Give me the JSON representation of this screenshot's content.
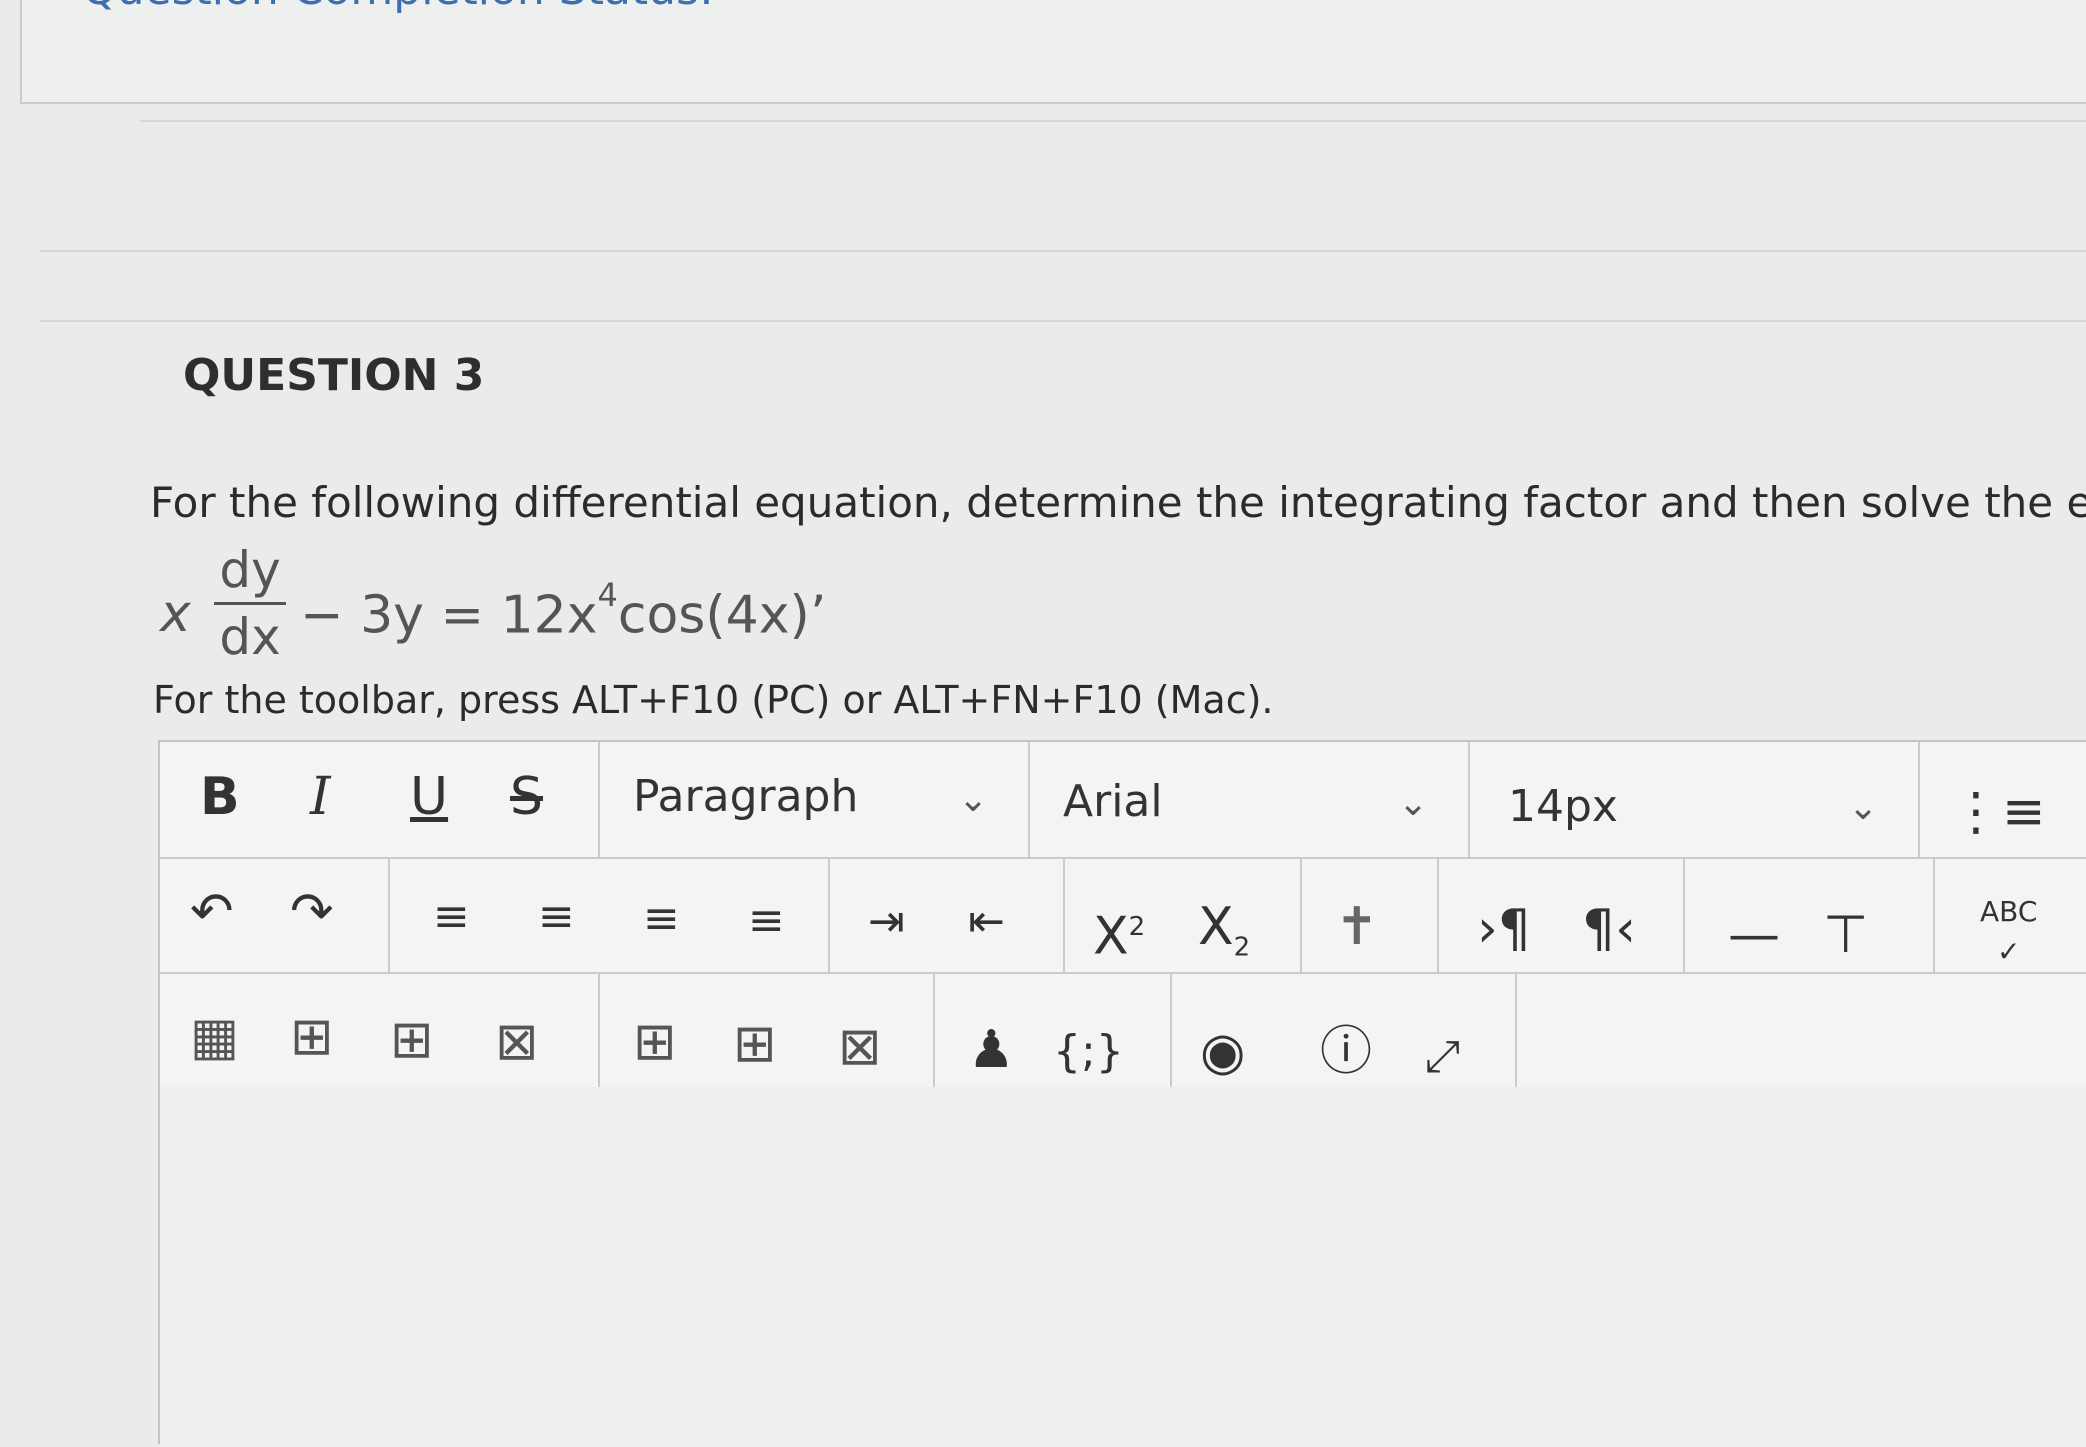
{
  "header": {
    "status_text": "Question Completion Status:"
  },
  "question": {
    "title": "QUESTION 3",
    "prompt": "For the following differential equation, determine the integrating factor and then solve the eq",
    "equation": {
      "lead": "x",
      "numerator": "dy",
      "denominator": "dx",
      "rest_before_exp": "− 3y = 12x",
      "exponent": "4",
      "rest_after_exp": "cos(4x)",
      "trailing": "’"
    },
    "hint": "For the toolbar, press ALT+F10 (PC) or ALT+FN+F10 (Mac)."
  },
  "toolbar": {
    "row1": {
      "bold": "B",
      "italic": "I",
      "underline": "U",
      "strike": "S",
      "paragraph": "Paragraph",
      "font": "Arial",
      "size": "14px"
    },
    "row2": {
      "superscript": "X",
      "sup_mark": "2",
      "subscript": "X",
      "sub_mark": "2",
      "spell": "ABC"
    },
    "row3": {
      "code": "{;}"
    }
  },
  "colors": {
    "accent": "#3c6fb0",
    "border": "#c9cccb"
  },
  "icons": [
    "bullet-list-icon",
    "undo-icon",
    "redo-icon",
    "align-left-icon",
    "align-center-icon",
    "align-right-icon",
    "justify-icon",
    "indent-icon",
    "outdent-icon",
    "unlink-icon",
    "ltr-icon",
    "rtl-icon",
    "horizontal-line-icon",
    "insert-content-icon",
    "spellcheck-icon",
    "table-icon",
    "table-row-icon",
    "table-col-icon",
    "table-delete-icon",
    "insert-col-icon",
    "insert-row-icon",
    "delete-cell-icon",
    "accessibility-icon",
    "code-icon",
    "preview-icon",
    "help-icon",
    "fullscreen-icon"
  ]
}
